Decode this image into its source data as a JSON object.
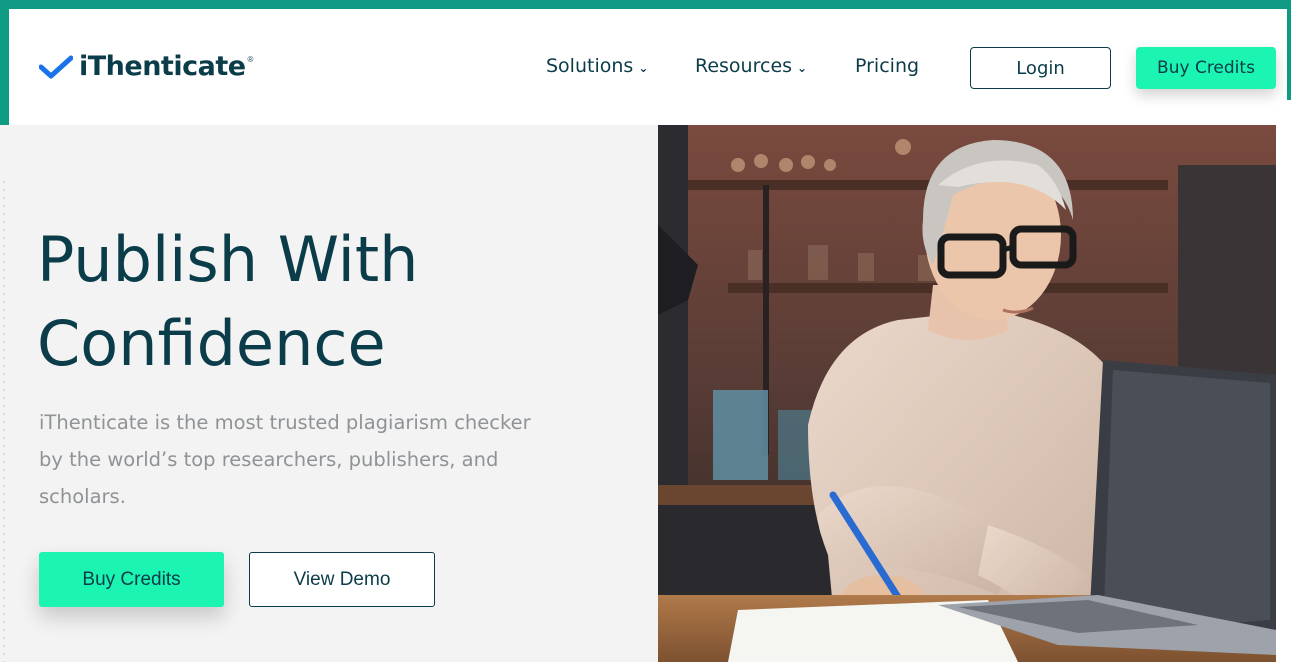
{
  "brand": {
    "name": "iThenticate",
    "registered_mark": "®",
    "primary_color": "#0b3c49",
    "accent_color": "#1cf5b2",
    "frame_color": "#0f9b83"
  },
  "nav": {
    "items": [
      {
        "label": "Solutions",
        "has_dropdown": true
      },
      {
        "label": "Resources",
        "has_dropdown": true
      },
      {
        "label": "Pricing",
        "has_dropdown": false
      }
    ],
    "chevron": "⌄",
    "login_label": "Login",
    "buy_credits_label": "Buy Credits"
  },
  "hero": {
    "title_line1": "Publish With",
    "title_line2": "Confidence",
    "subtitle_line1": "iThenticate is the most trusted plagiarism checker",
    "subtitle_line2": "by the world’s top researchers, publishers, and",
    "subtitle_line3": "scholars.",
    "primary_cta": "Buy Credits",
    "secondary_cta": "View Demo",
    "image": "woman-with-laptop-photo"
  }
}
